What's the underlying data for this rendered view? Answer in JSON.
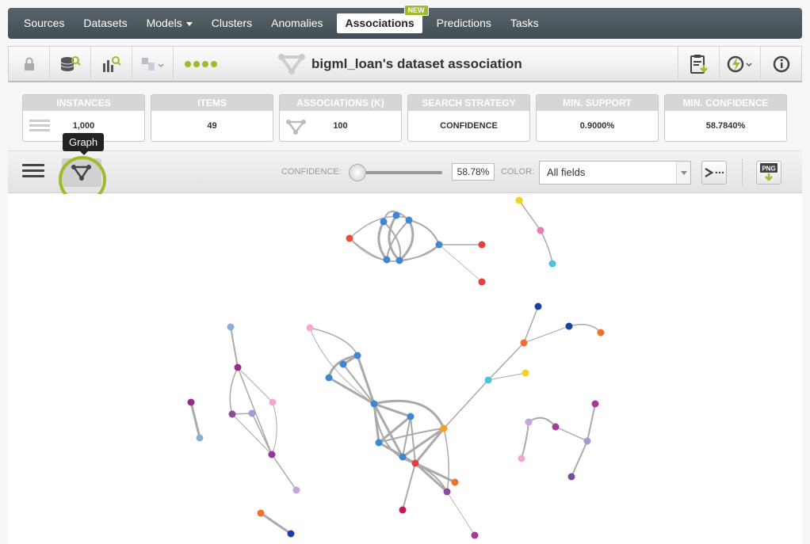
{
  "nav": {
    "items": [
      {
        "label": "Sources"
      },
      {
        "label": "Datasets"
      },
      {
        "label": "Models",
        "dropdown": true
      },
      {
        "label": "Clusters"
      },
      {
        "label": "Anomalies"
      },
      {
        "label": "Associations",
        "active": true,
        "badge": "NEW"
      },
      {
        "label": "Predictions"
      },
      {
        "label": "Tasks"
      }
    ]
  },
  "toolbar": {
    "title": "bigml_loan's dataset association"
  },
  "summary": {
    "instances": {
      "label": "INSTANCES",
      "value": "1,000"
    },
    "items": {
      "label": "ITEMS",
      "value": "49"
    },
    "associations": {
      "label": "ASSOCIATIONS (K)",
      "value": "100"
    },
    "search_strategy": {
      "label": "SEARCH STRATEGY",
      "value": "CONFIDENCE"
    },
    "min_support": {
      "label": "MIN. SUPPORT",
      "value": "0.9000%"
    },
    "min_confidence": {
      "label": "MIN. CONFIDENCE",
      "value": "58.7840%"
    }
  },
  "controls": {
    "tooltip": "Graph",
    "confidence_label": "CONFIDENCE:",
    "confidence_value": "58.78%",
    "color_label": "COLOR:",
    "color_selected": "All fields"
  },
  "colors": {
    "accent": "#9dbb2a",
    "nav_bg": "#4b555c"
  }
}
